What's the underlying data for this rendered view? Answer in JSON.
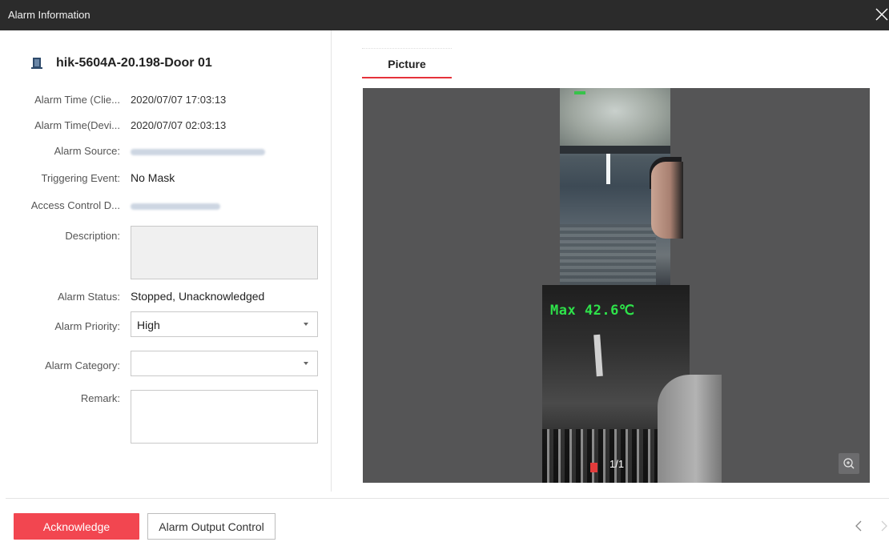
{
  "window": {
    "title": "Alarm Information"
  },
  "details": {
    "device_name": "hik-5604A-20.198-Door 01",
    "fields": [
      {
        "label": "Alarm Time (Clie...",
        "value": "2020/07/07 17:03:13"
      },
      {
        "label": "Alarm Time(Devi...",
        "value": "2020/07/07 02:03:13"
      },
      {
        "label": "Alarm Source:",
        "value": ""
      },
      {
        "label": "Triggering Event:",
        "value": "No Mask"
      },
      {
        "label": "Access Control D...",
        "value": ""
      },
      {
        "label": "Description:",
        "value": ""
      },
      {
        "label": "Alarm Status:",
        "value": "Stopped, Unacknowledged"
      },
      {
        "label": "Alarm Priority:",
        "value": "High"
      },
      {
        "label": "Alarm Category:",
        "value": ""
      },
      {
        "label": "Remark:",
        "value": ""
      }
    ]
  },
  "picture": {
    "tab_label": "Picture",
    "overlay_text": "Max 42.6℃",
    "counter": "1/1",
    "accent_color": "#e5323a"
  },
  "footer": {
    "acknowledge_label": "Acknowledge",
    "alarm_output_label": "Alarm Output Control",
    "ack_color": "#f24650"
  },
  "icons": [
    "close-icon",
    "door-icon",
    "chevron-down-icon",
    "zoom-in-icon",
    "chevron-left-icon",
    "chevron-right-icon"
  ]
}
